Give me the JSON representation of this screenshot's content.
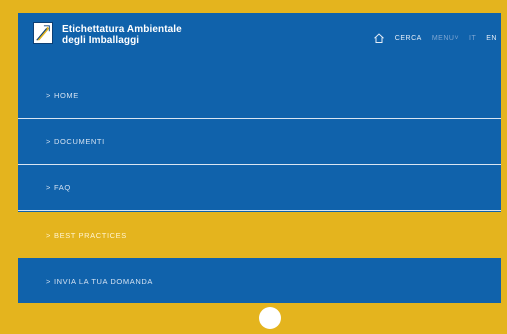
{
  "colors": {
    "frame": "#e4b41e",
    "screen": "#1062ab",
    "active_item": "#e4b41e"
  },
  "header": {
    "brand_line1": "Etichettatura Ambientale",
    "brand_line2": "degli Imballaggi",
    "logo_icon": "feather-leaf-logo",
    "home_icon": "home-icon",
    "search_label": "CERCA",
    "menu_label": "MENU",
    "menu_suffix": "˅",
    "lang_it": "IT",
    "lang_en": "EN"
  },
  "menu": {
    "items": [
      {
        "chevron": ">",
        "label": "HOME",
        "active": false
      },
      {
        "chevron": ">",
        "label": "DOCUMENTI",
        "active": false
      },
      {
        "chevron": ">",
        "label": "FAQ",
        "active": false
      },
      {
        "chevron": ">",
        "label": "BEST PRACTICES",
        "active": true
      },
      {
        "chevron": ">",
        "label": "INVIA LA TUA DOMANDA",
        "active": false
      }
    ]
  },
  "device": {
    "home_button_icon": "circle-home-button"
  }
}
